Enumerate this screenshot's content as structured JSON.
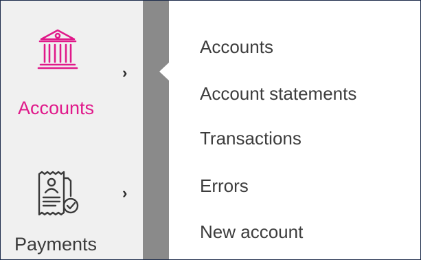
{
  "nav": {
    "accounts": {
      "label": "Accounts",
      "icon": "bank-icon",
      "active": true,
      "active_color": "#e0198a"
    },
    "payments": {
      "label": "Payments",
      "icon": "receipt-icon",
      "active": false
    }
  },
  "submenu": {
    "items": [
      {
        "label": "Accounts"
      },
      {
        "label": "Account statements"
      },
      {
        "label": "Transactions"
      },
      {
        "label": "Errors"
      },
      {
        "label": "New account"
      }
    ]
  }
}
